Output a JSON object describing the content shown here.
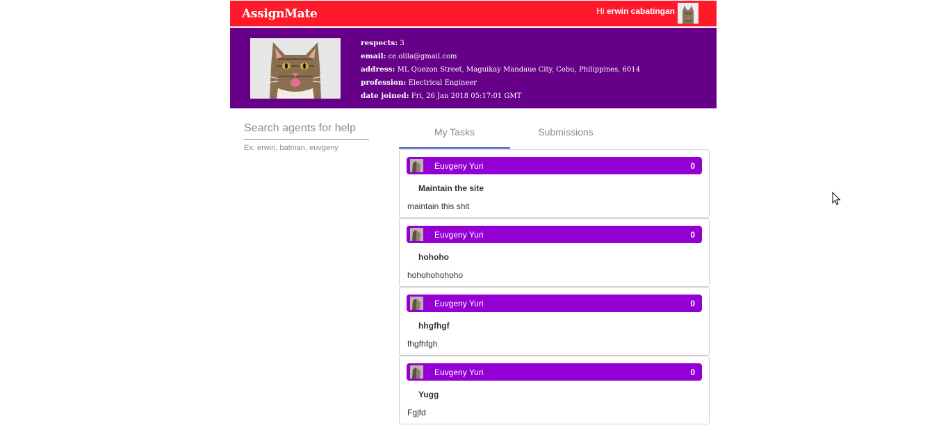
{
  "header": {
    "brand": "AssignMate",
    "greeting_prefix": "Hi ",
    "user_name": "erwin cabatingan"
  },
  "profile": {
    "fields": [
      {
        "key": "respects",
        "value": "3"
      },
      {
        "key": "email",
        "value": "ce.olila@gmail.com"
      },
      {
        "key": "address",
        "value": "ML Quezon Street, Maguikay Mandaue City, Cebu, Philippines, 6014"
      },
      {
        "key": "profession",
        "value": "Electrical Engineer"
      },
      {
        "key": "date joined",
        "value": "Fri, 26 Jan 2018 05:17:01 GMT"
      }
    ]
  },
  "search": {
    "placeholder": "Search agents for help",
    "hint": "Ex. erwin, batman, euvgeny"
  },
  "tabs": [
    {
      "label": "My Tasks",
      "active": true
    },
    {
      "label": "Submissions",
      "active": false
    }
  ],
  "tasks": [
    {
      "agent": "Euvgeny Yuri",
      "count": "0",
      "title": "Maintain the site",
      "description": "maintain this shit"
    },
    {
      "agent": "Euvgeny Yuri",
      "count": "0",
      "title": "hohoho",
      "description": "hohohohohoho"
    },
    {
      "agent": "Euvgeny Yuri",
      "count": "0",
      "title": "hhgfhgf",
      "description": "fhgfhfgh"
    },
    {
      "agent": "Euvgeny Yuri",
      "count": "0",
      "title": "Yugg",
      "description": "Fgjfd"
    }
  ],
  "colors": {
    "topbar": "#ff1a2b",
    "profile_bg": "#660088",
    "card_header": "#9400d3",
    "tab_indicator": "#3f51b5"
  },
  "icons": {
    "user_avatar": "cat-avatar",
    "profile_photo": "cat-photo",
    "cursor": "mouse-pointer-icon"
  }
}
